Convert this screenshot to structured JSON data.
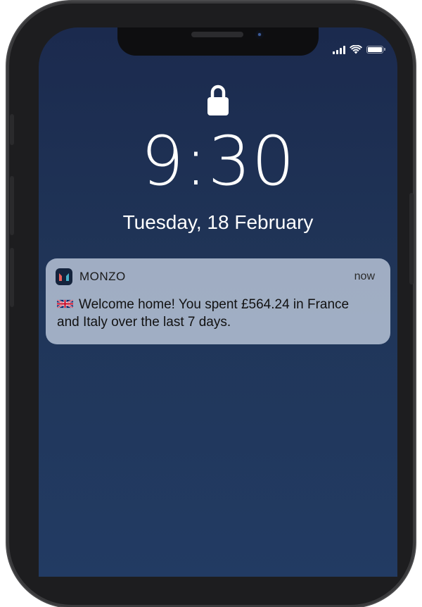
{
  "lock_screen": {
    "time": "9:30",
    "date": "Tuesday, 18 February"
  },
  "status_bar": {
    "icons": [
      "cellular-signal-icon",
      "wifi-icon",
      "battery-icon"
    ]
  },
  "notification": {
    "app_name": "MONZO",
    "app_icon": "monzo-logo-icon",
    "time": "now",
    "flag_icon": "uk-flag-icon",
    "message": "Welcome home! You spent £564.24 in France and Italy over the last 7 days."
  },
  "colors": {
    "wallpaper_top": "#1b2a4e",
    "wallpaper_bottom": "#223b63",
    "notification_bg": "#c4cfe2",
    "monzo_icon_bg": "#14233c"
  }
}
